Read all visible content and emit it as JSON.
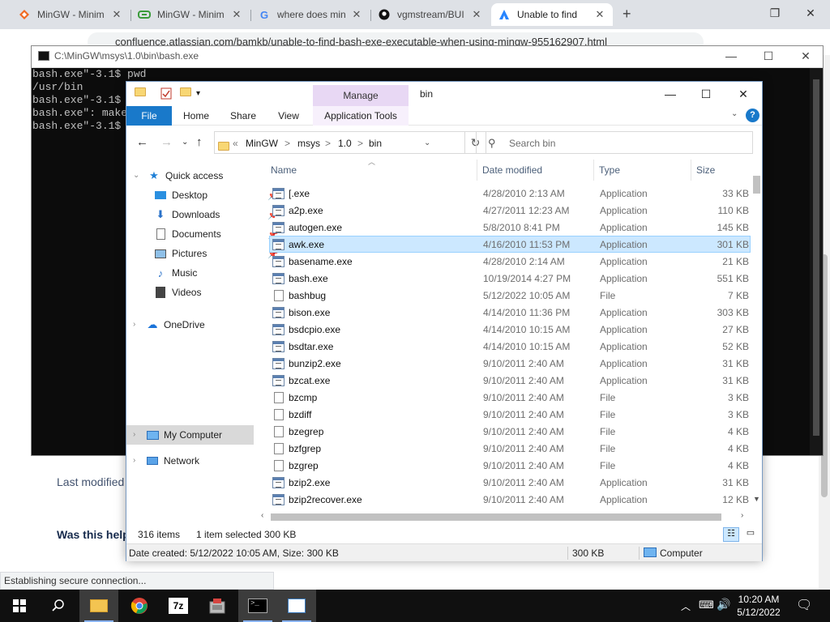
{
  "browser": {
    "tabs": [
      {
        "label": "MinGW - Minim",
        "icon": "sourceforge-icon"
      },
      {
        "label": "MinGW - Minim",
        "icon": "osdn-icon"
      },
      {
        "label": "where does min",
        "icon": "google-icon"
      },
      {
        "label": "vgmstream/BUI",
        "icon": "github-icon"
      },
      {
        "label": "Unable to find",
        "icon": "atlassian-icon"
      }
    ],
    "new_tab": "+",
    "address": "confluence.atlassian.com/bamkb/unable-to-find-bash-exe-executable-when-using-mingw-955162907.html",
    "status_bubble": "Establishing secure connection..."
  },
  "webpage": {
    "last_modified": "Last modified",
    "was_this_helpful": "Was this help"
  },
  "console": {
    "title": "C:\\MinGW\\msys\\1.0\\bin\\bash.exe",
    "lines": [
      "bash.exe\"-3.1$ pwd",
      "/usr/bin",
      "bash.exe\"-3.1$",
      "bash.exe\": make",
      "bash.exe\"-3.1$"
    ]
  },
  "explorer": {
    "title": "bin",
    "manage_label": "Manage",
    "ribbon_tabs": [
      "File",
      "Home",
      "Share",
      "View",
      "Application Tools"
    ],
    "help": "?",
    "breadcrumb": [
      "«",
      "MinGW",
      ">",
      "msys",
      ">",
      "1.0",
      ">",
      "bin"
    ],
    "search_placeholder": "Search bin",
    "nav": {
      "quick_access": "Quick access",
      "items": [
        "Desktop",
        "Downloads",
        "Documents",
        "Pictures",
        "Music",
        "Videos"
      ],
      "onedrive": "OneDrive",
      "my_computer": "My Computer",
      "network": "Network"
    },
    "columns": [
      "Name",
      "Date modified",
      "Type",
      "Size"
    ],
    "files": [
      {
        "name": "[.exe",
        "date": "4/28/2010 2:13 AM",
        "type": "Application",
        "size": "33 KB",
        "kind": "app"
      },
      {
        "name": "a2p.exe",
        "date": "4/27/2011 12:23 AM",
        "type": "Application",
        "size": "110 KB",
        "kind": "app"
      },
      {
        "name": "autogen.exe",
        "date": "5/8/2010 8:41 PM",
        "type": "Application",
        "size": "145 KB",
        "kind": "app"
      },
      {
        "name": "awk.exe",
        "date": "4/16/2010 11:53 PM",
        "type": "Application",
        "size": "301 KB",
        "kind": "app"
      },
      {
        "name": "basename.exe",
        "date": "4/28/2010 2:14 AM",
        "type": "Application",
        "size": "21 KB",
        "kind": "app"
      },
      {
        "name": "bash.exe",
        "date": "10/19/2014 4:27 PM",
        "type": "Application",
        "size": "551 KB",
        "kind": "app"
      },
      {
        "name": "bashbug",
        "date": "5/12/2022 10:05 AM",
        "type": "File",
        "size": "7 KB",
        "kind": "doc"
      },
      {
        "name": "bison.exe",
        "date": "4/14/2010 11:36 PM",
        "type": "Application",
        "size": "303 KB",
        "kind": "app"
      },
      {
        "name": "bsdcpio.exe",
        "date": "4/14/2010 10:15 AM",
        "type": "Application",
        "size": "27 KB",
        "kind": "app"
      },
      {
        "name": "bsdtar.exe",
        "date": "4/14/2010 10:15 AM",
        "type": "Application",
        "size": "52 KB",
        "kind": "app"
      },
      {
        "name": "bunzip2.exe",
        "date": "9/10/2011 2:40 AM",
        "type": "Application",
        "size": "31 KB",
        "kind": "app"
      },
      {
        "name": "bzcat.exe",
        "date": "9/10/2011 2:40 AM",
        "type": "Application",
        "size": "31 KB",
        "kind": "app"
      },
      {
        "name": "bzcmp",
        "date": "9/10/2011 2:40 AM",
        "type": "File",
        "size": "3 KB",
        "kind": "doc"
      },
      {
        "name": "bzdiff",
        "date": "9/10/2011 2:40 AM",
        "type": "File",
        "size": "3 KB",
        "kind": "doc"
      },
      {
        "name": "bzegrep",
        "date": "9/10/2011 2:40 AM",
        "type": "File",
        "size": "4 KB",
        "kind": "doc"
      },
      {
        "name": "bzfgrep",
        "date": "9/10/2011 2:40 AM",
        "type": "File",
        "size": "4 KB",
        "kind": "doc"
      },
      {
        "name": "bzgrep",
        "date": "9/10/2011 2:40 AM",
        "type": "File",
        "size": "4 KB",
        "kind": "doc"
      },
      {
        "name": "bzip2.exe",
        "date": "9/10/2011 2:40 AM",
        "type": "Application",
        "size": "31 KB",
        "kind": "app"
      },
      {
        "name": "bzip2recover.exe",
        "date": "9/10/2011 2:40 AM",
        "type": "Application",
        "size": "12 KB",
        "kind": "app"
      }
    ],
    "selected_file": "awk.exe",
    "status": {
      "count": "316 items",
      "selected": "1 item selected",
      "size": "300 KB"
    },
    "details": {
      "info": "Date created: 5/12/2022 10:05 AM, Size: 300 KB",
      "size": "300 KB",
      "location": "Computer"
    }
  },
  "taskbar": {
    "apps": [
      "file-explorer-icon",
      "chrome-icon",
      "7zip-icon",
      "installer-icon",
      "console-icon",
      "app-icon"
    ],
    "time": "10:20 AM",
    "date": "5/12/2022"
  }
}
